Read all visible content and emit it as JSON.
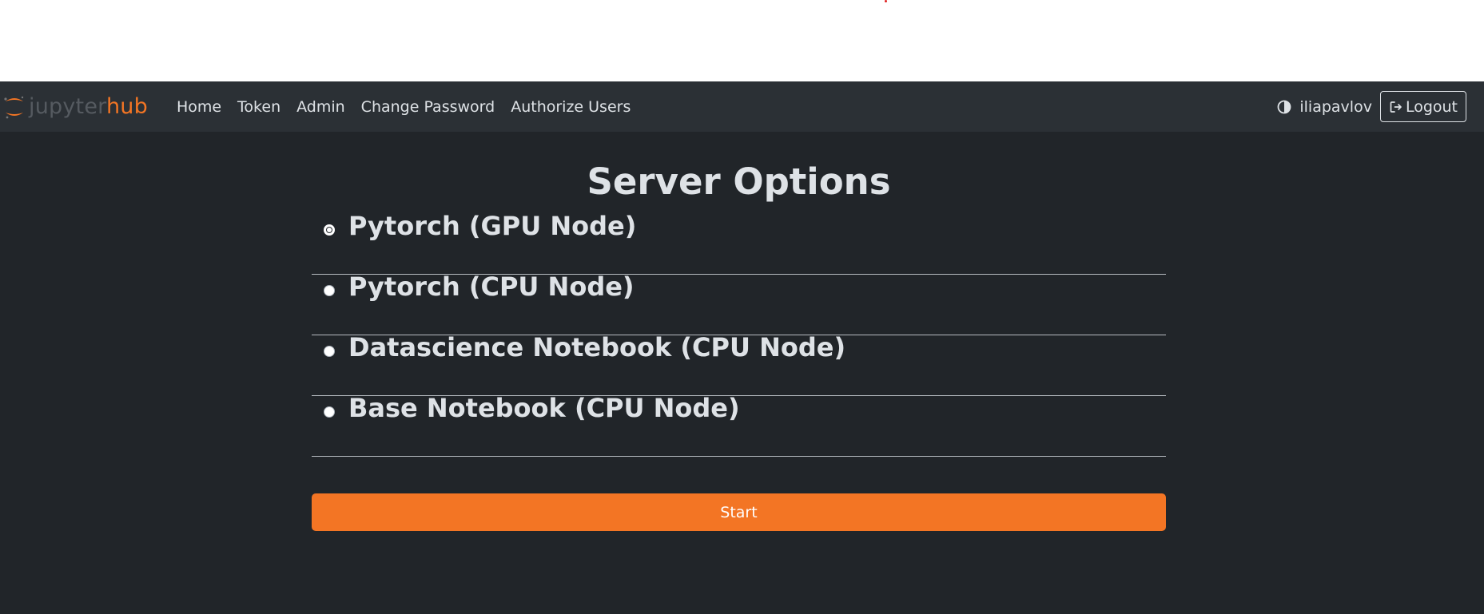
{
  "navbar": {
    "brand": {
      "part1": "jupyter",
      "part2": "hub"
    },
    "links": [
      {
        "label": "Home",
        "name": "nav-home"
      },
      {
        "label": "Token",
        "name": "nav-token"
      },
      {
        "label": "Admin",
        "name": "nav-admin"
      },
      {
        "label": "Change Password",
        "name": "nav-change-password"
      },
      {
        "label": "Authorize Users",
        "name": "nav-authorize-users"
      }
    ],
    "theme_icon": "half-circle-contrast-icon",
    "username": "iliapavlov",
    "logout_label": "Logout",
    "logout_icon": "sign-out-icon"
  },
  "main": {
    "title": "Server Options",
    "options": [
      {
        "label": "Pytorch (GPU Node)",
        "selected": true
      },
      {
        "label": "Pytorch (CPU Node)",
        "selected": false
      },
      {
        "label": "Datascience Notebook (CPU Node)",
        "selected": false
      },
      {
        "label": "Base Notebook (CPU Node)",
        "selected": false
      }
    ],
    "start_label": "Start"
  },
  "colors": {
    "navbar_bg": "#2b3035",
    "page_bg": "#212529",
    "accent": "#f37524",
    "text": "#dee2e6"
  }
}
